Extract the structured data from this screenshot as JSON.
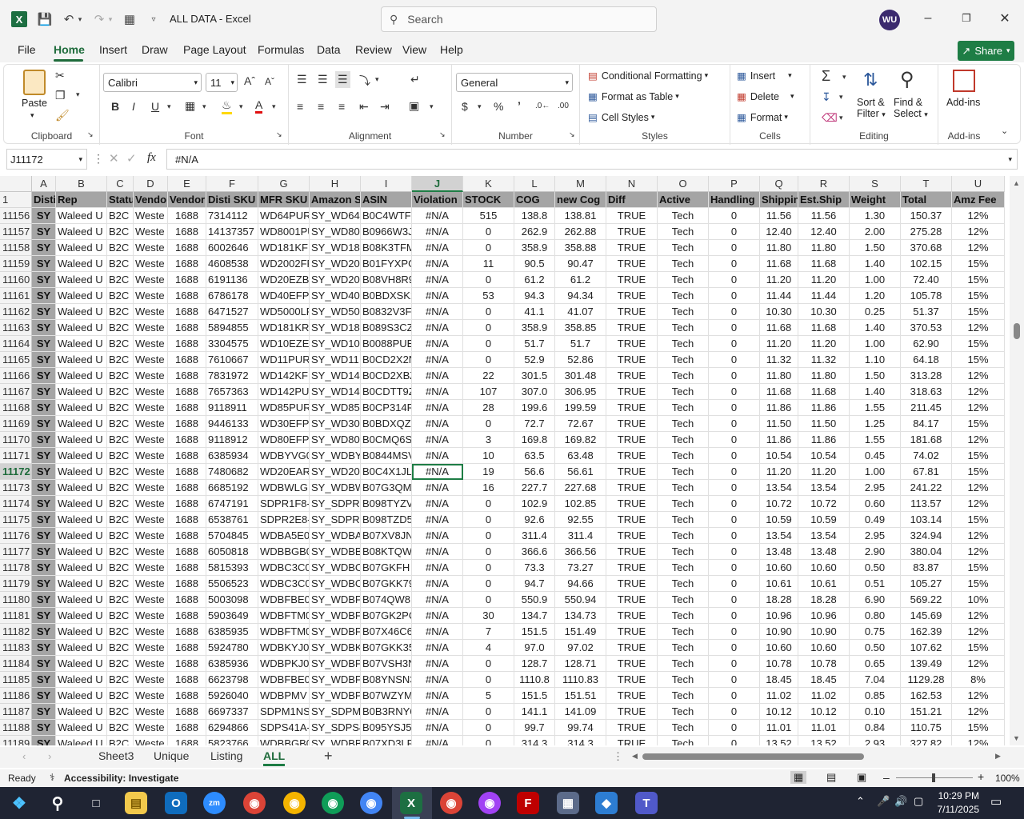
{
  "titlebar": {
    "title": "ALL DATA  -  Excel",
    "search_placeholder": "Search",
    "user_initials": "WU"
  },
  "menu": [
    "File",
    "Home",
    "Insert",
    "Draw",
    "Page Layout",
    "Formulas",
    "Data",
    "Review",
    "View",
    "Help"
  ],
  "share_label": "Share",
  "ribbon": {
    "paste": "Paste",
    "clipboard": "Clipboard",
    "font_name": "Calibri",
    "font_size": "11",
    "font": "Font",
    "alignment": "Alignment",
    "number_format": "General",
    "number": "Number",
    "cond_format": "Conditional Formatting",
    "format_table": "Format as Table",
    "cell_styles": "Cell Styles",
    "styles": "Styles",
    "insert": "Insert",
    "delete": "Delete",
    "format": "Format",
    "cells": "Cells",
    "sort_filter_1": "Sort &",
    "sort_filter_2": "Filter",
    "find_select_1": "Find &",
    "find_select_2": "Select",
    "editing": "Editing",
    "addins": "Add-ins",
    "addins_group": "Add-ins"
  },
  "formula": {
    "cell_ref": "J11172",
    "content": "#N/A"
  },
  "columns": [
    "A",
    "B",
    "C",
    "D",
    "E",
    "F",
    "G",
    "H",
    "I",
    "J",
    "K",
    "L",
    "M",
    "N",
    "O",
    "P",
    "Q",
    "R",
    "S",
    "T",
    "U"
  ],
  "header_row": {
    "num": "1",
    "cells": [
      "Disti",
      "Rep",
      "Statu",
      "Vendo",
      "Vendor",
      "Disti SKU",
      "MFR SKU",
      "Amazon S",
      "ASIN",
      "Violation",
      "STOCK",
      "COG",
      "new Cog",
      "Diff",
      "Active",
      "Handling",
      "Shippin",
      "Est.Ship",
      "Weight",
      "Total",
      "Amz Fee"
    ]
  },
  "rows": [
    [
      "11156",
      "SY",
      "Waleed U",
      "B2C",
      "Weste",
      "1688",
      "7314112",
      "WD64PUR",
      "SY_WD64",
      "B0C4WTF5",
      "#N/A",
      "515",
      "138.8",
      "138.81",
      "TRUE",
      "Tech",
      "0",
      "11.56",
      "11.56",
      "1.30",
      "150.37",
      "12%"
    ],
    [
      "11157",
      "SY",
      "Waleed U",
      "B2C",
      "Weste",
      "1688",
      "14137357",
      "WD8001PU",
      "SY_WD80",
      "B0966W3J",
      "#N/A",
      "0",
      "262.9",
      "262.88",
      "TRUE",
      "Tech",
      "0",
      "12.40",
      "12.40",
      "2.00",
      "275.28",
      "12%"
    ],
    [
      "11158",
      "SY",
      "Waleed U",
      "B2C",
      "Weste",
      "1688",
      "6002646",
      "WD181KF",
      "SY_WD18",
      "B08K3TFM",
      "#N/A",
      "0",
      "358.9",
      "358.88",
      "TRUE",
      "Tech",
      "0",
      "11.80",
      "11.80",
      "1.50",
      "370.68",
      "12%"
    ],
    [
      "11159",
      "SY",
      "Waleed U",
      "B2C",
      "Weste",
      "1688",
      "4608538",
      "WD2002FF",
      "SY_WD20",
      "B01FYXPG",
      "#N/A",
      "11",
      "90.5",
      "90.47",
      "TRUE",
      "Tech",
      "0",
      "11.68",
      "11.68",
      "1.40",
      "102.15",
      "15%"
    ],
    [
      "11160",
      "SY",
      "Waleed U",
      "B2C",
      "Weste",
      "1688",
      "6191136",
      "WD20EZB",
      "SY_WD20",
      "B08VH8R9",
      "#N/A",
      "0",
      "61.2",
      "61.2",
      "TRUE",
      "Tech",
      "0",
      "11.20",
      "11.20",
      "1.00",
      "72.40",
      "15%"
    ],
    [
      "11161",
      "SY",
      "Waleed U",
      "B2C",
      "Weste",
      "1688",
      "6786178",
      "WD40EFP",
      "SY_WD40",
      "B0BDXSK2",
      "#N/A",
      "53",
      "94.3",
      "94.34",
      "TRUE",
      "Tech",
      "0",
      "11.44",
      "11.44",
      "1.20",
      "105.78",
      "15%"
    ],
    [
      "11162",
      "SY",
      "Waleed U",
      "B2C",
      "Weste",
      "1688",
      "6471527",
      "WD5000LF",
      "SY_WD50",
      "B0832V3F",
      "#N/A",
      "0",
      "41.1",
      "41.07",
      "TRUE",
      "Tech",
      "0",
      "10.30",
      "10.30",
      "0.25",
      "51.37",
      "15%"
    ],
    [
      "11163",
      "SY",
      "Waleed U",
      "B2C",
      "Weste",
      "1688",
      "5894855",
      "WD181KR",
      "SY_WD18",
      "B089S3CZ",
      "#N/A",
      "0",
      "358.9",
      "358.85",
      "TRUE",
      "Tech",
      "0",
      "11.68",
      "11.68",
      "1.40",
      "370.53",
      "12%"
    ],
    [
      "11164",
      "SY",
      "Waleed U",
      "B2C",
      "Weste",
      "1688",
      "3304575",
      "WD10EZE",
      "SY_WD10",
      "B0088PUE",
      "#N/A",
      "0",
      "51.7",
      "51.7",
      "TRUE",
      "Tech",
      "0",
      "11.20",
      "11.20",
      "1.00",
      "62.90",
      "15%"
    ],
    [
      "11165",
      "SY",
      "Waleed U",
      "B2C",
      "Weste",
      "1688",
      "7610667",
      "WD11PUR",
      "SY_WD11",
      "B0CD2X2N",
      "#N/A",
      "0",
      "52.9",
      "52.86",
      "TRUE",
      "Tech",
      "0",
      "11.32",
      "11.32",
      "1.10",
      "64.18",
      "15%"
    ],
    [
      "11166",
      "SY",
      "Waleed U",
      "B2C",
      "Weste",
      "1688",
      "7831972",
      "WD142KF",
      "SY_WD14",
      "B0CD2XBZ",
      "#N/A",
      "22",
      "301.5",
      "301.48",
      "TRUE",
      "Tech",
      "0",
      "11.80",
      "11.80",
      "1.50",
      "313.28",
      "12%"
    ],
    [
      "11167",
      "SY",
      "Waleed U",
      "B2C",
      "Weste",
      "1688",
      "7657363",
      "WD142PU",
      "SY_WD14",
      "B0CDTT9Z",
      "#N/A",
      "107",
      "307.0",
      "306.95",
      "TRUE",
      "Tech",
      "0",
      "11.68",
      "11.68",
      "1.40",
      "318.63",
      "12%"
    ],
    [
      "11168",
      "SY",
      "Waleed U",
      "B2C",
      "Weste",
      "1688",
      "9118911",
      "WD85PUR",
      "SY_WD85",
      "B0CP314R",
      "#N/A",
      "28",
      "199.6",
      "199.59",
      "TRUE",
      "Tech",
      "0",
      "11.86",
      "11.86",
      "1.55",
      "211.45",
      "12%"
    ],
    [
      "11169",
      "SY",
      "Waleed U",
      "B2C",
      "Weste",
      "1688",
      "9446133",
      "WD30EFP",
      "SY_WD30",
      "B0BDXQZT",
      "#N/A",
      "0",
      "72.7",
      "72.67",
      "TRUE",
      "Tech",
      "0",
      "11.50",
      "11.50",
      "1.25",
      "84.17",
      "15%"
    ],
    [
      "11170",
      "SY",
      "Waleed U",
      "B2C",
      "Weste",
      "1688",
      "9118912",
      "WD80EFP",
      "SY_WD80",
      "B0CMQ6S",
      "#N/A",
      "3",
      "169.8",
      "169.82",
      "TRUE",
      "Tech",
      "0",
      "11.86",
      "11.86",
      "1.55",
      "181.68",
      "12%"
    ],
    [
      "11171",
      "SY",
      "Waleed U",
      "B2C",
      "Weste",
      "1688",
      "6385934",
      "WDBYVG0",
      "SY_WDBY",
      "B0844MSV",
      "#N/A",
      "10",
      "63.5",
      "63.48",
      "TRUE",
      "Tech",
      "0",
      "10.54",
      "10.54",
      "0.45",
      "74.02",
      "15%"
    ],
    [
      "11172",
      "SY",
      "Waleed U",
      "B2C",
      "Weste",
      "1688",
      "7480682",
      "WD20EAR",
      "SY_WD20",
      "B0C4X1JL",
      "#N/A",
      "19",
      "56.6",
      "56.61",
      "TRUE",
      "Tech",
      "0",
      "11.20",
      "11.20",
      "1.00",
      "67.81",
      "15%"
    ],
    [
      "11173",
      "SY",
      "Waleed U",
      "B2C",
      "Weste",
      "1688",
      "6685192",
      "WDBWLG",
      "SY_WDBW",
      "B07G3QM",
      "#N/A",
      "16",
      "227.7",
      "227.68",
      "TRUE",
      "Tech",
      "0",
      "13.54",
      "13.54",
      "2.95",
      "241.22",
      "12%"
    ],
    [
      "11174",
      "SY",
      "Waleed U",
      "B2C",
      "Weste",
      "1688",
      "6747191",
      "SDPR1F8-",
      "SY_SDPR1",
      "B098TYZV",
      "#N/A",
      "0",
      "102.9",
      "102.85",
      "TRUE",
      "Tech",
      "0",
      "10.72",
      "10.72",
      "0.60",
      "113.57",
      "12%"
    ],
    [
      "11175",
      "SY",
      "Waleed U",
      "B2C",
      "Weste",
      "1688",
      "6538761",
      "SDPR2E8-",
      "SY_SDPR2",
      "B098TZD5",
      "#N/A",
      "0",
      "92.6",
      "92.55",
      "TRUE",
      "Tech",
      "0",
      "10.59",
      "10.59",
      "0.49",
      "103.14",
      "15%"
    ],
    [
      "11176",
      "SY",
      "Waleed U",
      "B2C",
      "Weste",
      "1688",
      "5704845",
      "WDBA5E0",
      "SY_WDBA",
      "B07XV8JN",
      "#N/A",
      "0",
      "311.4",
      "311.4",
      "TRUE",
      "Tech",
      "0",
      "13.54",
      "13.54",
      "2.95",
      "324.94",
      "12%"
    ],
    [
      "11177",
      "SY",
      "Waleed U",
      "B2C",
      "Weste",
      "1688",
      "6050818",
      "WDBBGB0",
      "SY_WDBB",
      "B08KTQW",
      "#N/A",
      "0",
      "366.6",
      "366.56",
      "TRUE",
      "Tech",
      "0",
      "13.48",
      "13.48",
      "2.90",
      "380.04",
      "12%"
    ],
    [
      "11178",
      "SY",
      "Waleed U",
      "B2C",
      "Weste",
      "1688",
      "5815393",
      "WDBC3C0",
      "SY_WDBC",
      "B07GKFH",
      "#N/A",
      "0",
      "73.3",
      "73.27",
      "TRUE",
      "Tech",
      "0",
      "10.60",
      "10.60",
      "0.50",
      "83.87",
      "15%"
    ],
    [
      "11179",
      "SY",
      "Waleed U",
      "B2C",
      "Weste",
      "1688",
      "5506523",
      "WDBC3C0",
      "SY_WDBC",
      "B07GKK79",
      "#N/A",
      "0",
      "94.7",
      "94.66",
      "TRUE",
      "Tech",
      "0",
      "10.61",
      "10.61",
      "0.51",
      "105.27",
      "15%"
    ],
    [
      "11180",
      "SY",
      "Waleed U",
      "B2C",
      "Weste",
      "1688",
      "5003098",
      "WDBFBE0",
      "SY_WDBF",
      "B074QW8",
      "#N/A",
      "0",
      "550.9",
      "550.94",
      "TRUE",
      "Tech",
      "0",
      "18.28",
      "18.28",
      "6.90",
      "569.22",
      "10%"
    ],
    [
      "11181",
      "SY",
      "Waleed U",
      "B2C",
      "Weste",
      "1688",
      "5903649",
      "WDBFTM0",
      "SY_WDBF",
      "B07GK2PC",
      "#N/A",
      "30",
      "134.7",
      "134.73",
      "TRUE",
      "Tech",
      "0",
      "10.96",
      "10.96",
      "0.80",
      "145.69",
      "12%"
    ],
    [
      "11182",
      "SY",
      "Waleed U",
      "B2C",
      "Weste",
      "1688",
      "6385935",
      "WDBFTM0",
      "SY_WDBF",
      "B07X46C6",
      "#N/A",
      "7",
      "151.5",
      "151.49",
      "TRUE",
      "Tech",
      "0",
      "10.90",
      "10.90",
      "0.75",
      "162.39",
      "12%"
    ],
    [
      "11183",
      "SY",
      "Waleed U",
      "B2C",
      "Weste",
      "1688",
      "5924780",
      "WDBKYJ0",
      "SY_WDBK",
      "B07GKK35",
      "#N/A",
      "4",
      "97.0",
      "97.02",
      "TRUE",
      "Tech",
      "0",
      "10.60",
      "10.60",
      "0.50",
      "107.62",
      "15%"
    ],
    [
      "11184",
      "SY",
      "Waleed U",
      "B2C",
      "Weste",
      "1688",
      "6385936",
      "WDBPKJ0",
      "SY_WDBP",
      "B07VSH3N",
      "#N/A",
      "0",
      "128.7",
      "128.71",
      "TRUE",
      "Tech",
      "0",
      "10.78",
      "10.78",
      "0.65",
      "139.49",
      "12%"
    ],
    [
      "11185",
      "SY",
      "Waleed U",
      "B2C",
      "Weste",
      "1688",
      "6623798",
      "WDBFBE0",
      "SY_WDBF",
      "B08YNSN3",
      "#N/A",
      "0",
      "1110.8",
      "1110.83",
      "TRUE",
      "Tech",
      "0",
      "18.45",
      "18.45",
      "7.04",
      "1129.28",
      "8%"
    ],
    [
      "11186",
      "SY",
      "Waleed U",
      "B2C",
      "Weste",
      "1688",
      "5926040",
      "WDBPMV",
      "SY_WDBP",
      "B07WZYM",
      "#N/A",
      "5",
      "151.5",
      "151.51",
      "TRUE",
      "Tech",
      "0",
      "11.02",
      "11.02",
      "0.85",
      "162.53",
      "12%"
    ],
    [
      "11187",
      "SY",
      "Waleed U",
      "B2C",
      "Weste",
      "1688",
      "6697337",
      "SDPM1NS",
      "SY_SDPM",
      "B0B3RNY6",
      "#N/A",
      "0",
      "141.1",
      "141.09",
      "TRUE",
      "Tech",
      "0",
      "10.12",
      "10.12",
      "0.10",
      "151.21",
      "12%"
    ],
    [
      "11188",
      "SY",
      "Waleed U",
      "B2C",
      "Weste",
      "1688",
      "6294866",
      "SDPS41A-",
      "SY_SDPS4",
      "B095YSJ5Z",
      "#N/A",
      "0",
      "99.7",
      "99.74",
      "TRUE",
      "Tech",
      "0",
      "11.01",
      "11.01",
      "0.84",
      "110.75",
      "15%"
    ],
    [
      "11189",
      "SY",
      "Waleed U",
      "B2C",
      "Weste",
      "1688",
      "5823766",
      "WDBBGB0",
      "SY_WDBB",
      "B07XD3LP",
      "#N/A",
      "0",
      "314.3",
      "314.3",
      "TRUE",
      "Tech",
      "0",
      "13.52",
      "13.52",
      "2.93",
      "327.82",
      "12%"
    ]
  ],
  "sheets": [
    "Sheet3",
    "Unique",
    "Listing",
    "ALL"
  ],
  "status": {
    "ready": "Ready",
    "accessibility": "Accessibility: Investigate",
    "zoom": "100%"
  },
  "clock": {
    "time": "10:29 PM",
    "date": "7/11/2025"
  }
}
